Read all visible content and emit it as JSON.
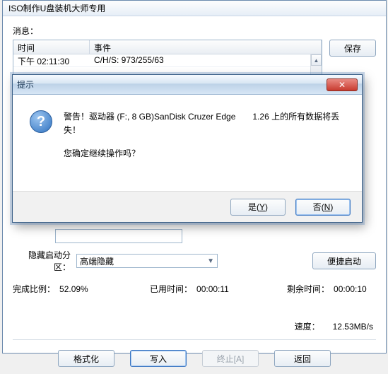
{
  "window": {
    "title": "ISO制作U盘装机大师专用"
  },
  "messages": {
    "group_label": "消息：",
    "headers": {
      "time": "时间",
      "event": "事件"
    },
    "rows": [
      {
        "time": "下午 02:11:30",
        "event": "C/H/S:  973/255/63"
      }
    ],
    "save_label": "保存"
  },
  "middle": {
    "path_field": "",
    "hidden_partition_label": "隐藏启动分区：",
    "hidden_partition_value": "高端隐藏",
    "portable_label": "便捷启动"
  },
  "progress": {
    "percent_label": "完成比例：",
    "percent_value": "52.09%",
    "elapsed_label": "已用时间：",
    "elapsed_value": "00:00:11",
    "remaining_label": "剩余时间：",
    "remaining_value": "00:00:10"
  },
  "speed": {
    "label": "速度：",
    "value": "12.53MB/s"
  },
  "buttons": {
    "format": "格式化",
    "write": "写入",
    "stop": "终止[A]",
    "back": "返回"
  },
  "dialog": {
    "title": "提示",
    "warning_line": "警告！驱动器 (F:, 8 GB)SanDisk Cruzer Edge　　1.26 上的所有数据将丢失！",
    "confirm_line": "您确定继续操作吗？",
    "yes": "是",
    "yes_key": "Y",
    "no": "否",
    "no_key": "N"
  }
}
